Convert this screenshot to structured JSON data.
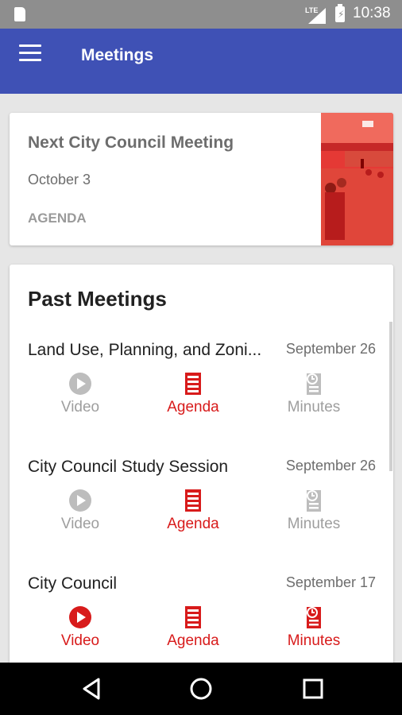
{
  "status_bar": {
    "time": "10:38",
    "network": "LTE",
    "icons": [
      "sd-card-icon",
      "signal-icon",
      "battery-charging-icon"
    ]
  },
  "app_bar": {
    "title": "Meetings",
    "menu_icon": "hamburger-menu-icon"
  },
  "next_meeting": {
    "heading": "Next City Council Meeting",
    "date": "October 3",
    "agenda_link": "AGENDA",
    "photo_tint": "#e53935"
  },
  "past_meetings": {
    "heading": "Past Meetings",
    "items": [
      {
        "name": "Land Use, Planning, and Zoni...",
        "date": "September 26",
        "video": {
          "label": "Video",
          "available": false
        },
        "agenda": {
          "label": "Agenda",
          "available": true
        },
        "minutes": {
          "label": "Minutes",
          "available": false
        }
      },
      {
        "name": "City Council Study Session",
        "date": "September 26",
        "video": {
          "label": "Video",
          "available": false
        },
        "agenda": {
          "label": "Agenda",
          "available": true
        },
        "minutes": {
          "label": "Minutes",
          "available": false
        }
      },
      {
        "name": "City Council",
        "date": "September 17",
        "video": {
          "label": "Video",
          "available": true
        },
        "agenda": {
          "label": "Agenda",
          "available": true
        },
        "minutes": {
          "label": "Minutes",
          "available": true
        }
      }
    ]
  },
  "colors": {
    "app_bar": "#3f51b5",
    "status_bar": "#8e8e8e",
    "accent_red": "#d81b1b",
    "disabled_gray": "#9e9e9e",
    "background": "#e6e6e6"
  },
  "nav_bar": {
    "icons": [
      "back-icon",
      "home-icon",
      "recents-icon"
    ]
  }
}
